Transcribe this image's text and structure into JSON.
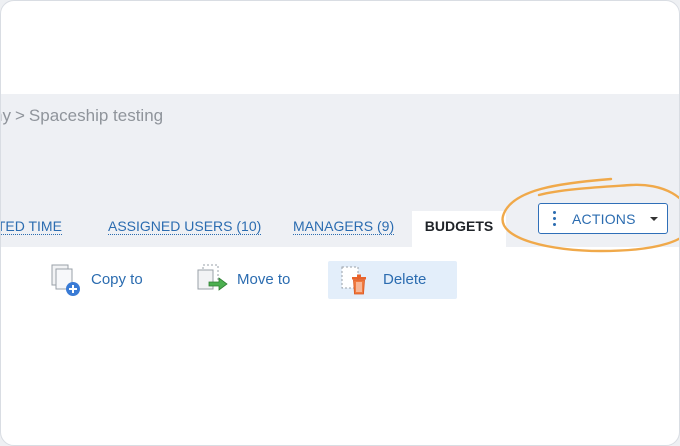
{
  "breadcrumb": {
    "previous": "ny",
    "separator": ">",
    "current": "Spaceship testing"
  },
  "tabs": [
    {
      "label": "RTED TIME"
    },
    {
      "label": "ASSIGNED USERS (10)"
    },
    {
      "label": "MANAGERS (9)"
    },
    {
      "label": "BUDGETS",
      "active": true
    }
  ],
  "actions": {
    "label": "ACTIONS",
    "icon": "vertical-dots-icon",
    "caret": "caret-down-icon"
  },
  "toolbar": {
    "copy_label": "Copy to",
    "move_label": "Move to",
    "delete_label": "Delete"
  },
  "colors": {
    "link": "#2b6cb0",
    "header_band": "#eef0f4",
    "annotation": "#f0a94a",
    "delete_highlight": "#e3eefa"
  }
}
